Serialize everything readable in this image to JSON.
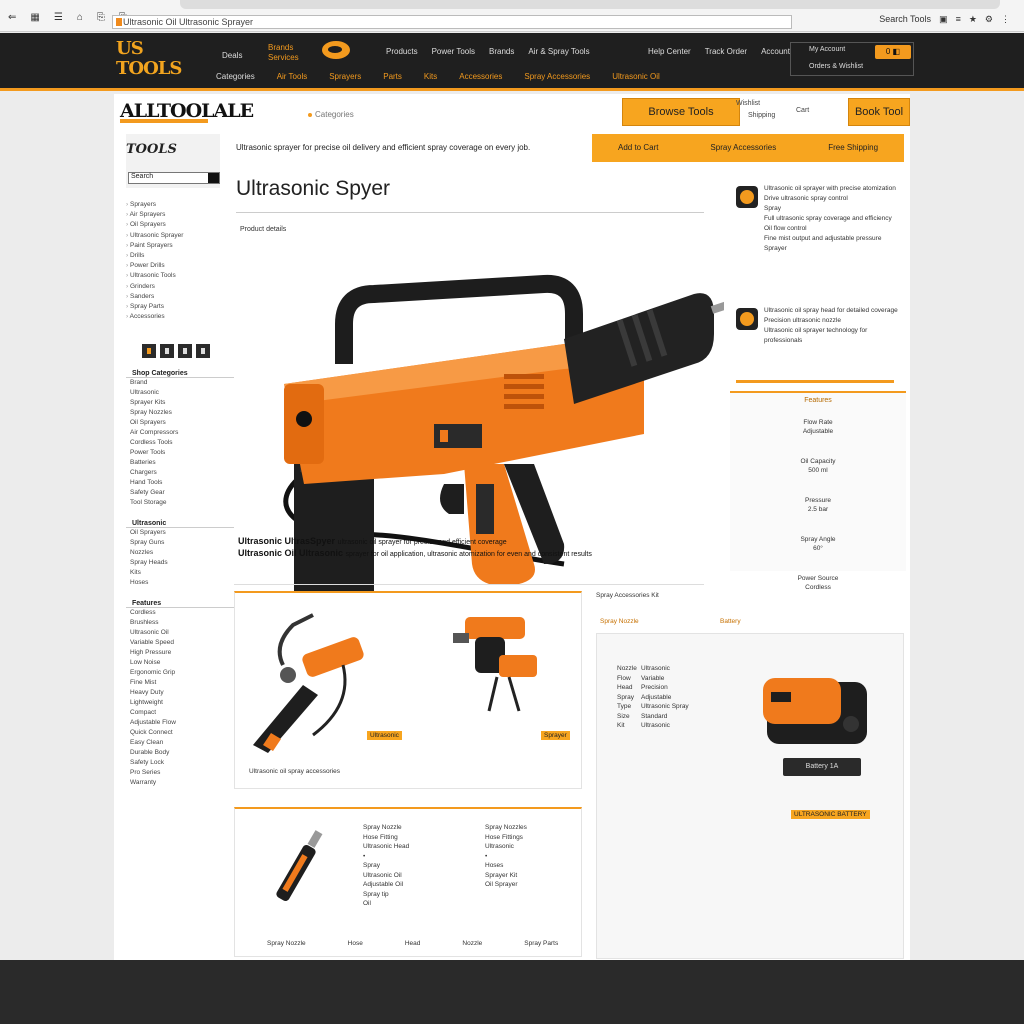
{
  "browser": {
    "address": "Ultrasonic Oil Ultrasonic Sprayer",
    "left_icons": [
      "⇐",
      "▦",
      "☰",
      "⌂",
      "⎘",
      "⎘"
    ],
    "right_items": [
      "Search Tools",
      "▣",
      "≡",
      "★",
      "⚙",
      "⋮"
    ]
  },
  "header": {
    "logo_text": "US TOOLS",
    "col1": [
      "Deals",
      "Categories"
    ],
    "col2": [
      "Brands",
      "Services"
    ],
    "top_links": [
      "Products",
      "Power Tools",
      "Brands",
      "Air & Spray Tools"
    ],
    "top_links_right": [
      "Help Center",
      "Track Order",
      "Account"
    ],
    "nav": [
      "Categories",
      "Air Tools",
      "Sprayers",
      "Parts",
      "Kits",
      "Accessories",
      "Spray Accessories",
      "Ultrasonic Oil"
    ],
    "account_line1": "My Account",
    "account_line2": "Orders & Wishlist",
    "cart_label": "0 ◧"
  },
  "brandbar": {
    "brand": "ALLTOOLALE",
    "search_placeholder": "Categories",
    "btn_primary": "Browse Tools",
    "mini1": "Wishlist",
    "mini2": "Shipping",
    "mini3": "Cart",
    "btn_secondary": "Book Tool"
  },
  "sidebar": {
    "logo": "TOOLS",
    "search_placeholder": "Search",
    "categories": [
      "Sprayers",
      "Air Sprayers",
      "Oil Sprayers",
      "Ultrasonic Sprayer",
      "Paint Sprayers",
      "Drills",
      "Power Drills",
      "Ultrasonic Tools",
      "Grinders",
      "Sanders",
      "Spray Parts",
      "Accessories"
    ],
    "filter_heading": "Shop Categories",
    "filter_items": [
      "Brand",
      "Ultrasonic",
      "Sprayer Kits",
      "Spray Nozzles",
      "Oil Sprayers",
      "Air Compressors",
      "Cordless Tools",
      "Power Tools",
      "Batteries",
      "Chargers",
      "Hand Tools",
      "Safety Gear",
      "Tool Storage"
    ],
    "section2": "Ultrasonic",
    "section2_items": [
      "Oil Sprayers",
      "Spray Guns",
      "Nozzles",
      "Spray Heads",
      "Kits",
      "Hoses"
    ],
    "section3": "Features",
    "section3_items": [
      "Cordless",
      "Brushless",
      "Ultrasonic Oil",
      "Variable Speed",
      "High Pressure",
      "Low Noise",
      "Ergonomic Grip",
      "Fine Mist",
      "Heavy Duty",
      "Lightweight",
      "Compact",
      "Adjustable Flow",
      "Quick Connect",
      "Easy Clean",
      "Durable Body",
      "Safety Lock",
      "Pro Series",
      "Warranty"
    ]
  },
  "main": {
    "banner_left": "Ultrasonic sprayer for precise oil delivery and efficient spray coverage on every job.",
    "banner_right": [
      "Add to Cart",
      "Spray Accessories",
      "Free Shipping"
    ],
    "title": "Ultrasonic Spyer",
    "breadcrumb": "Product details",
    "desc_line1": "Ultrasonic UltrasSpyer",
    "desc_line1_rest": "ultrasonic oil sprayer for precise and efficient coverage",
    "desc_line2_bold": "Ultrasonic Oil Ultrasonic",
    "desc_line2_rest": "sprayer for oil application, ultrasonic atomization for even and consistent results"
  },
  "specs": {
    "items": [
      [
        "Ultrasonic oil sprayer with precise atomization",
        "Drive ultrasonic spray control",
        "Spray",
        "Full ultrasonic spray coverage and efficiency",
        "Oil flow control",
        "Fine mist output and adjustable pressure",
        "Sprayer"
      ],
      [
        "Ultrasonic oil spray head for detailed coverage",
        "Precision ultrasonic nozzle",
        "Ultrasonic oil sprayer technology for professionals"
      ]
    ],
    "box_heading": "Features",
    "box_lines": [
      "Flow Rate",
      "Oil Capacity",
      "Pressure",
      "Spray Angle",
      "Power Source"
    ],
    "box_values": [
      "Adjustable",
      "500 ml",
      "2.5 bar",
      "60°",
      "Cordless"
    ]
  },
  "lower": {
    "tag1": "Ultrasonic",
    "tag2": "Sprayer",
    "caption1": "Ultrasonic oil spray accessories",
    "right_heading": "Spray Accessories Kit",
    "right_sub1": "Spray Nozzle",
    "right_sub2": "Battery",
    "right_list_a": [
      "Nozzle",
      "Flow",
      "Head",
      "Spray",
      "Type",
      "Size",
      "Kit"
    ],
    "right_list_b": [
      "Ultrasonic",
      "Variable",
      "Precision",
      "Adjustable",
      "Ultrasonic Spray",
      "Standard",
      "Ultrasonic"
    ],
    "battery_label": "Battery 1A",
    "right_tag": "ULTRASONIC BATTERY",
    "bottom_col1": [
      "Spray Nozzle",
      "Hose Fitting",
      "Ultrasonic Head",
      "•",
      "Spray",
      "Ultrasonic Oil",
      "Adjustable Oil",
      "Spray tip",
      "Oil"
    ],
    "bottom_col2": [
      "Spray Nozzles",
      "Hose Fittings",
      "Ultrasonic",
      "•",
      "Hoses",
      "Sprayer Kit",
      "Oil Sprayer"
    ],
    "bottom_row": [
      "Spray Nozzle",
      "Hose",
      "Head",
      "Nozzle",
      "Spray Parts"
    ]
  },
  "colors": {
    "accent": "#f39a1e",
    "header_bg": "#1f1f1f",
    "tool_orange": "#f07a1c"
  }
}
